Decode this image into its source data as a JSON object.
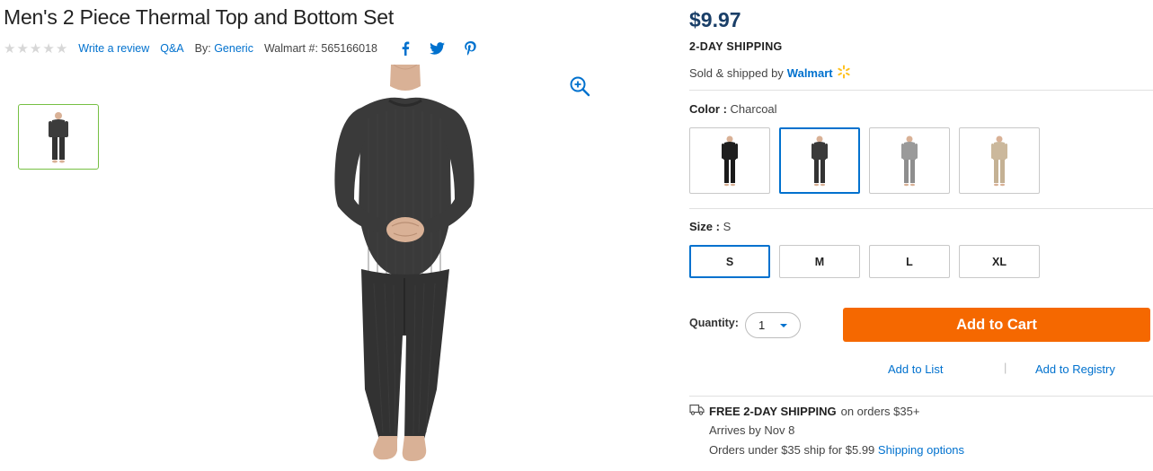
{
  "product": {
    "title": "Men's 2 Piece Thermal Top and Bottom Set",
    "rating_stars": 5,
    "write_review": "Write a review",
    "qa": "Q&A",
    "by_label": "By:",
    "brand": "Generic",
    "item_number_label": "Walmart #:",
    "item_number": "565166018"
  },
  "social": {
    "facebook_icon": "facebook-icon",
    "twitter_icon": "twitter-icon",
    "pinterest_icon": "pinterest-icon"
  },
  "gallery": {
    "zoom_icon": "zoom-in-icon",
    "thumbnail_count": 1
  },
  "buy_box": {
    "price": "$9.97",
    "shipping_heading": "2-DAY SHIPPING",
    "sold_by_prefix": "Sold & shipped by",
    "seller": "Walmart",
    "color_label": "Color",
    "color_value": "Charcoal",
    "colors": [
      "Black",
      "Charcoal",
      "Grey",
      "Khaki"
    ],
    "selected_color_index": 1,
    "size_label": "Size",
    "size_value": "S",
    "sizes": [
      "S",
      "M",
      "L",
      "XL"
    ],
    "selected_size_index": 0,
    "quantity_label": "Quantity:",
    "quantity_value": "1",
    "add_to_cart": "Add to Cart",
    "add_to_list": "Add to List",
    "separator": "|",
    "add_to_registry": "Add to Registry"
  },
  "shipping_info": {
    "free_shipping": "FREE 2-DAY SHIPPING",
    "free_shipping_suffix": "on orders $35+",
    "arrives": "Arrives by Nov 8",
    "orders_under": "Orders under $35 ship for $5.99",
    "shipping_options": "Shipping options"
  },
  "colors": {
    "accent_blue": "#0071ce",
    "price_navy": "#1a3f68",
    "cart_orange": "#f56800",
    "thumb_green": "#76c043",
    "spark_yellow": "#ffc220"
  }
}
